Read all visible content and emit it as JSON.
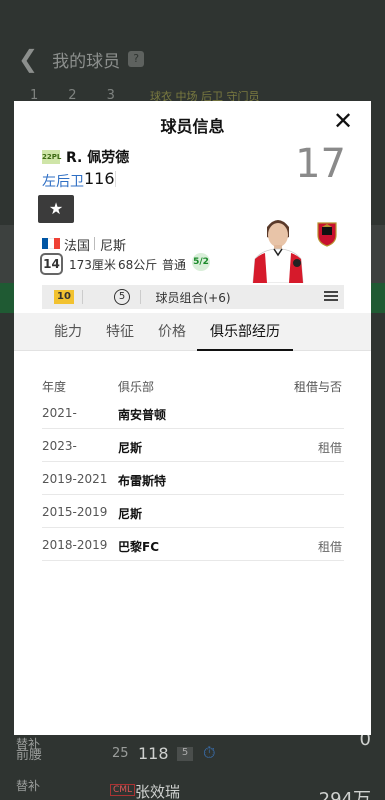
{
  "background": {
    "title": "我的球员",
    "help_icon": "?",
    "tabs": [
      "1",
      "2",
      "3"
    ],
    "legend": "球衣 中场 后卫 守门员",
    "rows": [
      {
        "label": "替补",
        "position": "前腰",
        "age": "25",
        "rating": "118",
        "badge": "5",
        "right_value": "0"
      },
      {
        "label": "替补",
        "tag": "CML",
        "name": "张效瑞",
        "right_value": "294万"
      }
    ]
  },
  "modal": {
    "title": "球员信息",
    "close_icon": "close-icon",
    "league_badge": "22PL",
    "player_name": "R. 佩劳德",
    "position": "左后卫",
    "rating": "116",
    "jersey_number": "17",
    "nation": "法国",
    "club": "尼斯",
    "age": "14",
    "height": "173厘米",
    "weight": "68公斤",
    "body_type": "普通",
    "foot": "5/2",
    "chem_level": "10",
    "chem_count": "5",
    "chem_text": "球员组合(+6)",
    "colors": {
      "position": "#2f6fc4",
      "chem_gold": "#f2c230",
      "flag": [
        "#0055a4",
        "#ffffff",
        "#ef4135"
      ]
    }
  },
  "tabs": [
    {
      "label": "能力"
    },
    {
      "label": "特征"
    },
    {
      "label": "价格"
    },
    {
      "label": "俱乐部经历",
      "active": true
    }
  ],
  "history": {
    "headers": {
      "year": "年度",
      "club": "俱乐部",
      "loan": "租借与否"
    },
    "rows": [
      {
        "year": "2021-",
        "club": "南安普顿",
        "loan": ""
      },
      {
        "year": "2023-",
        "club": "尼斯",
        "loan": "租借"
      },
      {
        "year": "2019-2021",
        "club": "布雷斯特",
        "loan": ""
      },
      {
        "year": "2015-2019",
        "club": "尼斯",
        "loan": ""
      },
      {
        "year": "2018-2019",
        "club": "巴黎FC",
        "loan": "租借"
      }
    ]
  }
}
